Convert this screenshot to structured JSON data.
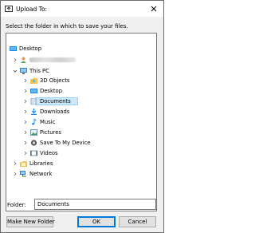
{
  "title": "Upload To:",
  "instruction": "Select the folder in which to save your files.",
  "tree": {
    "desktop_root": "Desktop",
    "user_name": "",
    "this_pc": "This PC",
    "items": [
      "3D Objects",
      "Desktop",
      "Documents",
      "Downloads",
      "Music",
      "Pictures",
      "Save To My Device",
      "Videos"
    ],
    "libraries": "Libraries",
    "network": "Network",
    "selected": "Documents"
  },
  "folder_label": "Folder:",
  "folder_value": "Documents",
  "buttons": {
    "new_folder": "Make New Folder",
    "ok": "OK",
    "cancel": "Cancel"
  },
  "colors": {
    "selection": "#cce8ff",
    "folder": "#f2c55c",
    "accent": "#0078d7"
  }
}
